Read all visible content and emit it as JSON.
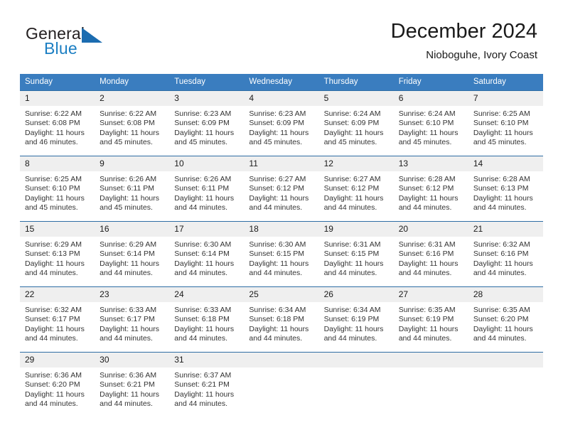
{
  "brand": {
    "name_top": "General",
    "name_bottom": "Blue",
    "triangle_icon": "brand-triangle-icon",
    "color_dark": "#231f20",
    "color_blue": "#1c7fc3"
  },
  "header": {
    "title": "December 2024",
    "subtitle": "Nioboguhe, Ivory Coast"
  },
  "theme": {
    "header_bg": "#3a7dbf",
    "row_divider": "#2e6da4",
    "daynum_bg": "#efefef"
  },
  "calendar": {
    "weekday_headers": [
      "Sunday",
      "Monday",
      "Tuesday",
      "Wednesday",
      "Thursday",
      "Friday",
      "Saturday"
    ],
    "weeks": [
      [
        {
          "day": "1",
          "sunrise": "Sunrise: 6:22 AM",
          "sunset": "Sunset: 6:08 PM",
          "daylight": "Daylight: 11 hours and 46 minutes."
        },
        {
          "day": "2",
          "sunrise": "Sunrise: 6:22 AM",
          "sunset": "Sunset: 6:08 PM",
          "daylight": "Daylight: 11 hours and 45 minutes."
        },
        {
          "day": "3",
          "sunrise": "Sunrise: 6:23 AM",
          "sunset": "Sunset: 6:09 PM",
          "daylight": "Daylight: 11 hours and 45 minutes."
        },
        {
          "day": "4",
          "sunrise": "Sunrise: 6:23 AM",
          "sunset": "Sunset: 6:09 PM",
          "daylight": "Daylight: 11 hours and 45 minutes."
        },
        {
          "day": "5",
          "sunrise": "Sunrise: 6:24 AM",
          "sunset": "Sunset: 6:09 PM",
          "daylight": "Daylight: 11 hours and 45 minutes."
        },
        {
          "day": "6",
          "sunrise": "Sunrise: 6:24 AM",
          "sunset": "Sunset: 6:10 PM",
          "daylight": "Daylight: 11 hours and 45 minutes."
        },
        {
          "day": "7",
          "sunrise": "Sunrise: 6:25 AM",
          "sunset": "Sunset: 6:10 PM",
          "daylight": "Daylight: 11 hours and 45 minutes."
        }
      ],
      [
        {
          "day": "8",
          "sunrise": "Sunrise: 6:25 AM",
          "sunset": "Sunset: 6:10 PM",
          "daylight": "Daylight: 11 hours and 45 minutes."
        },
        {
          "day": "9",
          "sunrise": "Sunrise: 6:26 AM",
          "sunset": "Sunset: 6:11 PM",
          "daylight": "Daylight: 11 hours and 45 minutes."
        },
        {
          "day": "10",
          "sunrise": "Sunrise: 6:26 AM",
          "sunset": "Sunset: 6:11 PM",
          "daylight": "Daylight: 11 hours and 44 minutes."
        },
        {
          "day": "11",
          "sunrise": "Sunrise: 6:27 AM",
          "sunset": "Sunset: 6:12 PM",
          "daylight": "Daylight: 11 hours and 44 minutes."
        },
        {
          "day": "12",
          "sunrise": "Sunrise: 6:27 AM",
          "sunset": "Sunset: 6:12 PM",
          "daylight": "Daylight: 11 hours and 44 minutes."
        },
        {
          "day": "13",
          "sunrise": "Sunrise: 6:28 AM",
          "sunset": "Sunset: 6:12 PM",
          "daylight": "Daylight: 11 hours and 44 minutes."
        },
        {
          "day": "14",
          "sunrise": "Sunrise: 6:28 AM",
          "sunset": "Sunset: 6:13 PM",
          "daylight": "Daylight: 11 hours and 44 minutes."
        }
      ],
      [
        {
          "day": "15",
          "sunrise": "Sunrise: 6:29 AM",
          "sunset": "Sunset: 6:13 PM",
          "daylight": "Daylight: 11 hours and 44 minutes."
        },
        {
          "day": "16",
          "sunrise": "Sunrise: 6:29 AM",
          "sunset": "Sunset: 6:14 PM",
          "daylight": "Daylight: 11 hours and 44 minutes."
        },
        {
          "day": "17",
          "sunrise": "Sunrise: 6:30 AM",
          "sunset": "Sunset: 6:14 PM",
          "daylight": "Daylight: 11 hours and 44 minutes."
        },
        {
          "day": "18",
          "sunrise": "Sunrise: 6:30 AM",
          "sunset": "Sunset: 6:15 PM",
          "daylight": "Daylight: 11 hours and 44 minutes."
        },
        {
          "day": "19",
          "sunrise": "Sunrise: 6:31 AM",
          "sunset": "Sunset: 6:15 PM",
          "daylight": "Daylight: 11 hours and 44 minutes."
        },
        {
          "day": "20",
          "sunrise": "Sunrise: 6:31 AM",
          "sunset": "Sunset: 6:16 PM",
          "daylight": "Daylight: 11 hours and 44 minutes."
        },
        {
          "day": "21",
          "sunrise": "Sunrise: 6:32 AM",
          "sunset": "Sunset: 6:16 PM",
          "daylight": "Daylight: 11 hours and 44 minutes."
        }
      ],
      [
        {
          "day": "22",
          "sunrise": "Sunrise: 6:32 AM",
          "sunset": "Sunset: 6:17 PM",
          "daylight": "Daylight: 11 hours and 44 minutes."
        },
        {
          "day": "23",
          "sunrise": "Sunrise: 6:33 AM",
          "sunset": "Sunset: 6:17 PM",
          "daylight": "Daylight: 11 hours and 44 minutes."
        },
        {
          "day": "24",
          "sunrise": "Sunrise: 6:33 AM",
          "sunset": "Sunset: 6:18 PM",
          "daylight": "Daylight: 11 hours and 44 minutes."
        },
        {
          "day": "25",
          "sunrise": "Sunrise: 6:34 AM",
          "sunset": "Sunset: 6:18 PM",
          "daylight": "Daylight: 11 hours and 44 minutes."
        },
        {
          "day": "26",
          "sunrise": "Sunrise: 6:34 AM",
          "sunset": "Sunset: 6:19 PM",
          "daylight": "Daylight: 11 hours and 44 minutes."
        },
        {
          "day": "27",
          "sunrise": "Sunrise: 6:35 AM",
          "sunset": "Sunset: 6:19 PM",
          "daylight": "Daylight: 11 hours and 44 minutes."
        },
        {
          "day": "28",
          "sunrise": "Sunrise: 6:35 AM",
          "sunset": "Sunset: 6:20 PM",
          "daylight": "Daylight: 11 hours and 44 minutes."
        }
      ],
      [
        {
          "day": "29",
          "sunrise": "Sunrise: 6:36 AM",
          "sunset": "Sunset: 6:20 PM",
          "daylight": "Daylight: 11 hours and 44 minutes."
        },
        {
          "day": "30",
          "sunrise": "Sunrise: 6:36 AM",
          "sunset": "Sunset: 6:21 PM",
          "daylight": "Daylight: 11 hours and 44 minutes."
        },
        {
          "day": "31",
          "sunrise": "Sunrise: 6:37 AM",
          "sunset": "Sunset: 6:21 PM",
          "daylight": "Daylight: 11 hours and 44 minutes."
        },
        {
          "day": "",
          "sunrise": "",
          "sunset": "",
          "daylight": ""
        },
        {
          "day": "",
          "sunrise": "",
          "sunset": "",
          "daylight": ""
        },
        {
          "day": "",
          "sunrise": "",
          "sunset": "",
          "daylight": ""
        },
        {
          "day": "",
          "sunrise": "",
          "sunset": "",
          "daylight": ""
        }
      ]
    ]
  }
}
